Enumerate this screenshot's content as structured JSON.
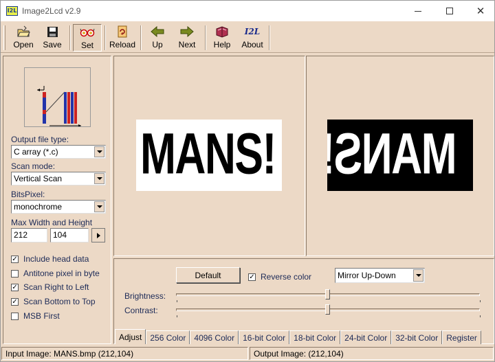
{
  "window": {
    "title": "Image2Lcd v2.9",
    "app_icon_text": "I2L"
  },
  "toolbar": {
    "buttons": [
      {
        "label": "Open",
        "icon": "open-folder-icon"
      },
      {
        "label": "Save",
        "icon": "floppy-disk-icon"
      },
      {
        "label": "Set",
        "icon": "glasses-icon",
        "pressed": true
      },
      {
        "label": "Reload",
        "icon": "reload-icon"
      },
      {
        "label": "Up",
        "icon": "arrow-left-icon"
      },
      {
        "label": "Next",
        "icon": "arrow-right-icon"
      },
      {
        "label": "Help",
        "icon": "help-book-icon"
      },
      {
        "label": "About",
        "icon": "i2l-logo-icon"
      }
    ],
    "about_logo_text": "I2L"
  },
  "settings": {
    "output_file_type_label": "Output file type:",
    "output_file_type_value": "C array (*.c)",
    "scan_mode_label": "Scan mode:",
    "scan_mode_value": "Vertical Scan",
    "bits_pixel_label": "BitsPixel:",
    "bits_pixel_value": "monochrome",
    "max_size_label": "Max Width and Height",
    "max_width": "212",
    "max_height": "104",
    "checkboxes": [
      {
        "label": "Include head data",
        "checked": true
      },
      {
        "label": "Antitone pixel in byte",
        "checked": false
      },
      {
        "label": "Scan Right to Left",
        "checked": true
      },
      {
        "label": "Scan Bottom to Top",
        "checked": true
      },
      {
        "label": "MSB First",
        "checked": false
      }
    ]
  },
  "preview": {
    "input_text": "MANS!",
    "output_text": "MANS!"
  },
  "adjust": {
    "default_label": "Default",
    "reverse_color_label": "Reverse color",
    "reverse_color_checked": true,
    "mirror_value": "Mirror Up-Down",
    "brightness_label": "Brightness:",
    "contrast_label": "Contrast:",
    "brightness_level": 0.5,
    "contrast_level": 0.5
  },
  "tabs": [
    "Adjust",
    "256 Color",
    "4096 Color",
    "16-bit Color",
    "18-bit Color",
    "24-bit Color",
    "32-bit Color",
    "Register"
  ],
  "status": {
    "input": "Input Image: MANS.bmp (212,104)",
    "output": "Output Image: (212,104)"
  },
  "colors": {
    "face": "#ecd9c6",
    "label_text": "#1c2a57"
  }
}
